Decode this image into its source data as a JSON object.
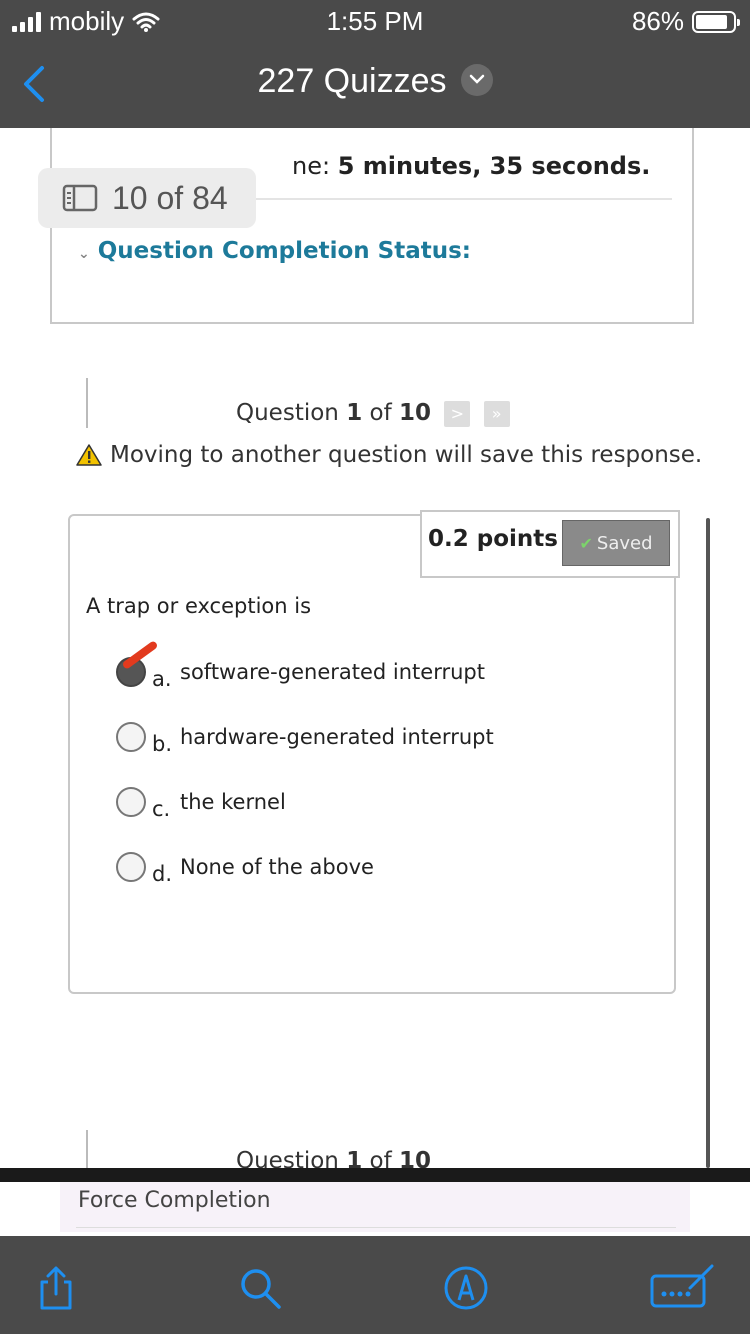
{
  "status_bar": {
    "carrier": "mobily",
    "time": "1:55 PM",
    "battery": "86%"
  },
  "nav": {
    "title": "227 Quizzes",
    "back_icon": "chevron-left-icon",
    "dropdown_icon": "chevron-down-icon"
  },
  "page_indicator": {
    "label": "10 of 84"
  },
  "info": {
    "time_prefix": "ne:",
    "time_value": "5 minutes, 35 seconds.",
    "completion_status": "Question Completion Status:"
  },
  "question_nav": {
    "prefix": "Question",
    "current": "1",
    "of_word": "of",
    "total": "10",
    "next_symbol": ">",
    "last_symbol": "»",
    "warning": "Moving to another question will save this response."
  },
  "question": {
    "points": "0.2 points",
    "saved_label": "Saved",
    "text": "A trap or exception is",
    "options": [
      {
        "letter": "a.",
        "text": "software-generated interrupt",
        "selected": true
      },
      {
        "letter": "b.",
        "text": "hardware-generated interrupt",
        "selected": false
      },
      {
        "letter": "c.",
        "text": "the kernel",
        "selected": false
      },
      {
        "letter": "d.",
        "text": "None of the above",
        "selected": false
      }
    ]
  },
  "footer": {
    "force_completion": "Force Completion"
  },
  "toolbar": [
    "share-icon",
    "search-icon",
    "markup-icon",
    "keyboard-icon"
  ],
  "colors": {
    "bar_bg": "#4a4a4a",
    "accent_blue": "#1e8ff0",
    "status_teal": "#1d7a9a",
    "progress_green": "#58b15b"
  }
}
